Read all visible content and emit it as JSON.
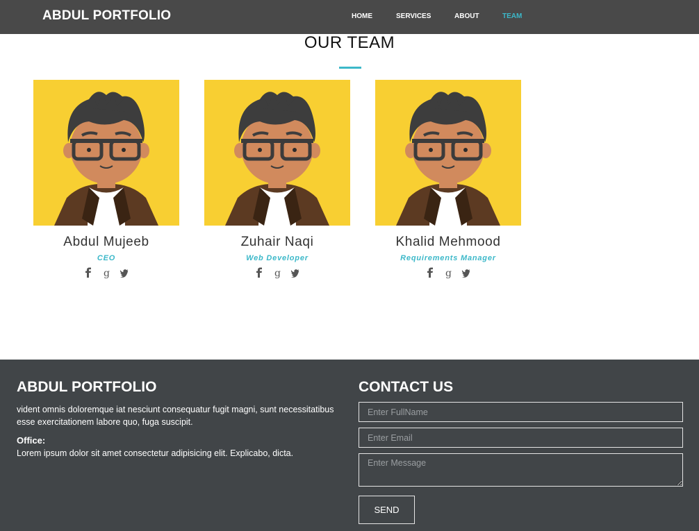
{
  "navbar": {
    "brand": "ABDUL PORTFOLIO",
    "links": [
      {
        "label": "HOME",
        "active": false
      },
      {
        "label": "SERVICES",
        "active": false
      },
      {
        "label": "ABOUT",
        "active": false
      },
      {
        "label": "TEAM",
        "active": true
      }
    ]
  },
  "team": {
    "title": "OUR TEAM",
    "members": [
      {
        "name": "Abdul Mujeeb",
        "role": "CEO",
        "socials": [
          "facebook-icon",
          "google-plus-icon",
          "twitter-icon"
        ]
      },
      {
        "name": "Zuhair Naqi",
        "role": "Web Developer",
        "socials": [
          "facebook-icon",
          "google-plus-icon",
          "twitter-icon"
        ]
      },
      {
        "name": "Khalid Mehmood",
        "role": "Requirements Manager",
        "socials": [
          "facebook-icon",
          "google-plus-icon",
          "twitter-icon"
        ]
      }
    ]
  },
  "footer": {
    "brand": "ABDUL PORTFOLIO",
    "text": "vident omnis doloremque iat nesciunt consequatur fugit magni, sunt necessitatibus esse exercitationem labore quo, fuga suscipit.",
    "office_label": "Office:",
    "office_text": "Lorem ipsum dolor sit amet consectetur adipisicing elit. Explicabo, dicta."
  },
  "contact": {
    "title": "CONTACT US",
    "name_placeholder": "Enter FullName",
    "email_placeholder": "Enter Email",
    "message_placeholder": "Enter Message",
    "send_label": "SEND"
  },
  "colors": {
    "navbar_bg": "#494949",
    "accent": "#3cb8c9",
    "footer_bg": "#414548",
    "avatar_bg": "#f8cf32"
  }
}
